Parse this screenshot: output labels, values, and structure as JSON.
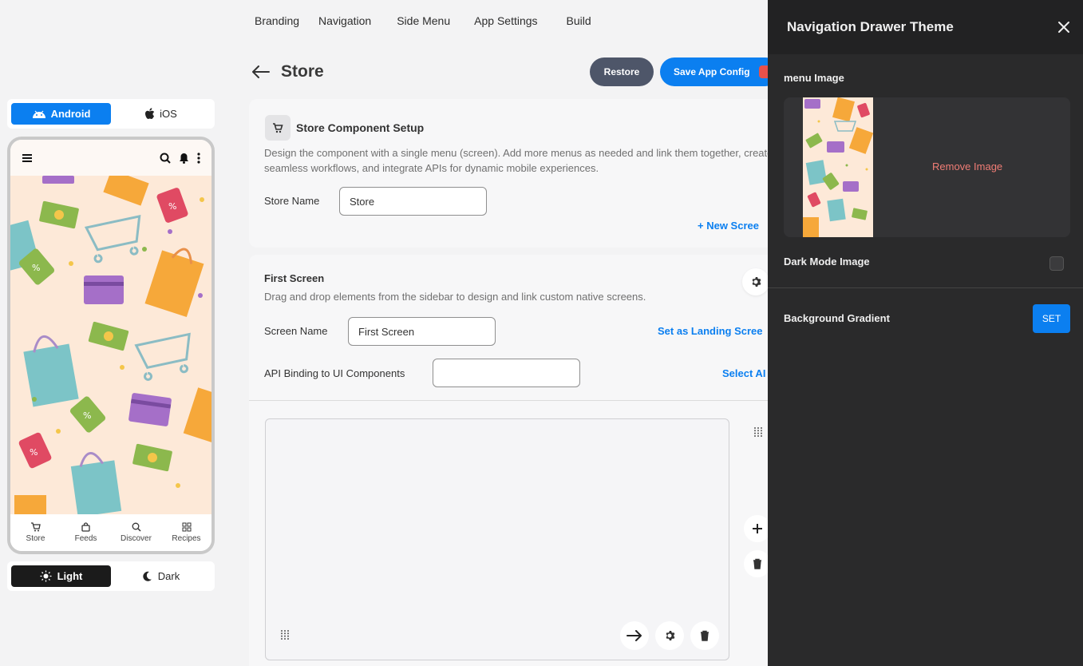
{
  "topnav": [
    "Branding",
    "Navigation",
    "Side Menu",
    "App Settings",
    "Build"
  ],
  "page": {
    "title": "Store"
  },
  "actions": {
    "restore": "Restore",
    "save": "Save App Config"
  },
  "platform": {
    "android": "Android",
    "ios": "iOS"
  },
  "theme": {
    "light": "Light",
    "dark": "Dark"
  },
  "phone_nav": [
    {
      "label": "Store",
      "icon": "cart-icon"
    },
    {
      "label": "Feeds",
      "icon": "bag-icon"
    },
    {
      "label": "Discover",
      "icon": "search-zoom-icon"
    },
    {
      "label": "Recipes",
      "icon": "grid-icon"
    }
  ],
  "setup": {
    "title": "Store Component Setup",
    "description": "Design the component with a single menu (screen). Add more menus as needed and link them together, create seamless workflows, and integrate APIs for dynamic mobile experiences.",
    "store_name_label": "Store Name",
    "store_name_value": "Store",
    "new_screen": "New Scree"
  },
  "screen": {
    "title": "First Screen",
    "description": "Drag and drop elements from the sidebar to design and link custom native screens.",
    "screen_name_label": "Screen Name",
    "screen_name_value": "First Screen",
    "landing": "Set as Landing Scree",
    "api_label": "API Binding to UI Components",
    "api_value": "",
    "select_api": "Select AI"
  },
  "drawer": {
    "title": "Navigation Drawer Theme",
    "menu_image": "menu Image",
    "remove_image": "Remove Image",
    "dark_mode_image": "Dark Mode Image",
    "background_gradient": "Background Gradient",
    "set": "SET"
  },
  "colors": {
    "accent": "#0b7ff0",
    "restore": "#4e5669",
    "drawer_bg": "#2a2a2b",
    "danger": "#f07d75"
  }
}
